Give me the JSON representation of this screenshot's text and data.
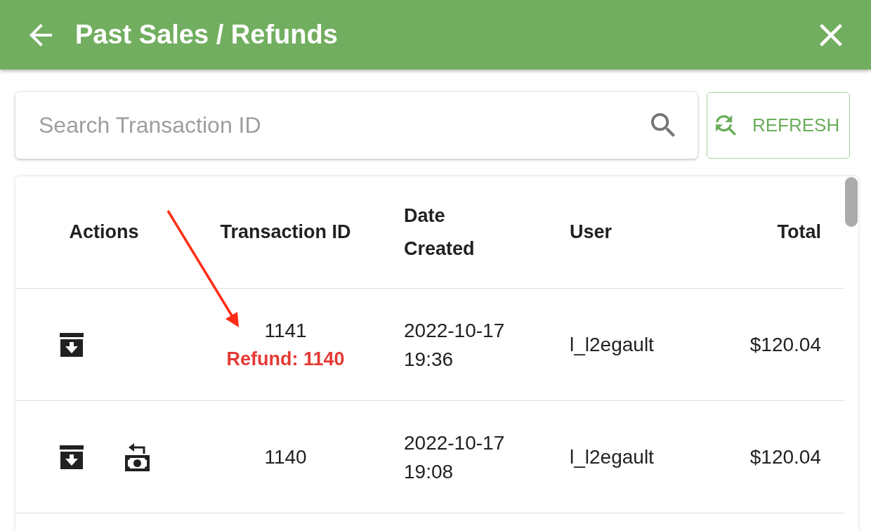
{
  "header": {
    "title": "Past Sales / Refunds"
  },
  "search": {
    "placeholder": "Search Transaction ID"
  },
  "refresh_button": {
    "label": "REFRESH"
  },
  "table": {
    "columns": [
      "Actions",
      "Transaction ID",
      "Date Created",
      "User",
      "Total"
    ],
    "rows": [
      {
        "actions": [
          {
            "kind": "archive"
          }
        ],
        "transaction_id": "1141",
        "refund_note": "Refund: 1140",
        "date_created": "2022-10-17 19:36",
        "user": "l_l2egault",
        "total": "$120.04"
      },
      {
        "actions": [
          {
            "kind": "archive"
          },
          {
            "kind": "refund"
          }
        ],
        "transaction_id": "1140",
        "date_created": "2022-10-17 19:08",
        "user": "l_l2egault",
        "total": "$120.04"
      }
    ]
  }
}
